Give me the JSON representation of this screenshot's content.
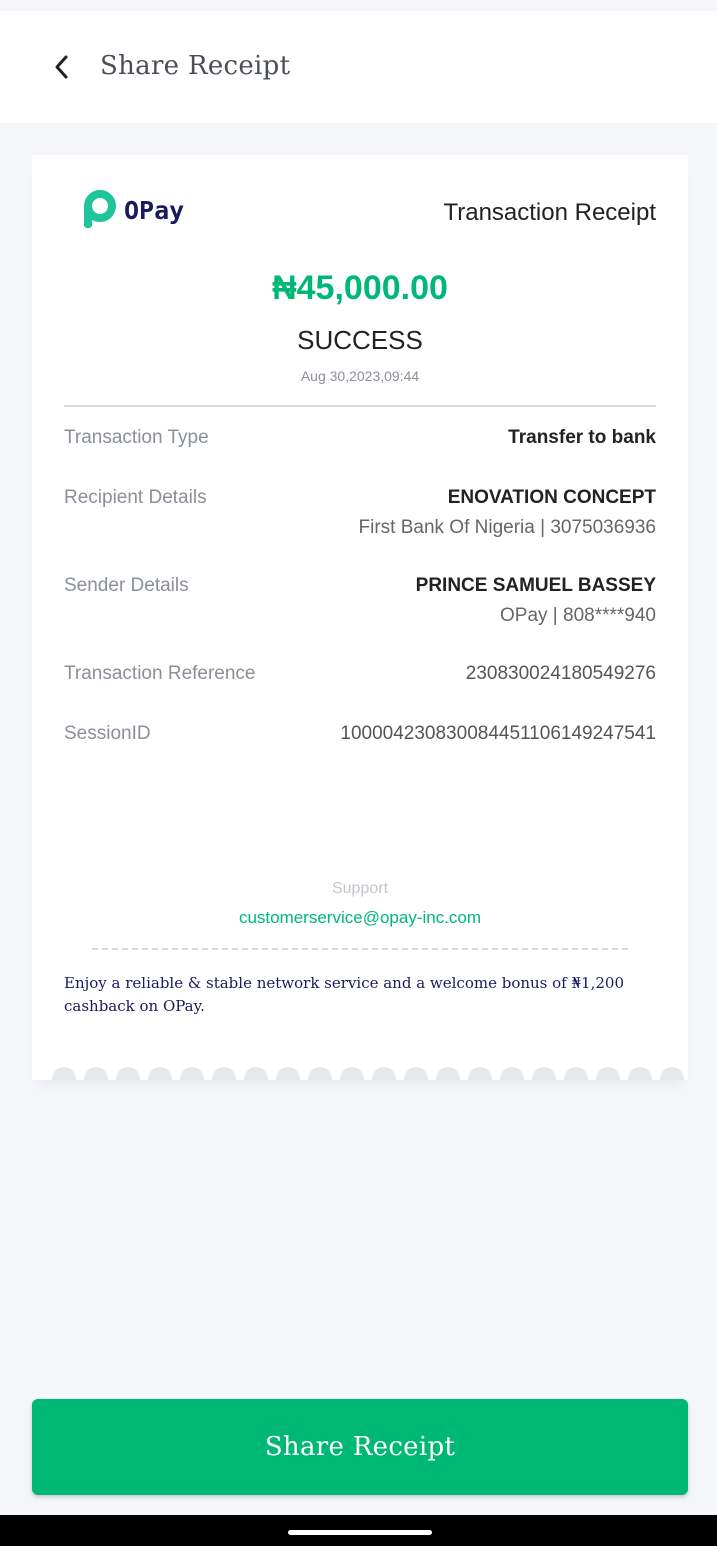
{
  "header": {
    "title": "Share Receipt",
    "back_icon": "chevron-left-icon"
  },
  "receipt": {
    "brand": "OPay",
    "title": "Transaction Receipt",
    "amount": "₦45,000.00",
    "status": "SUCCESS",
    "datetime": "Aug 30,2023,09:44",
    "rows": {
      "type": {
        "label": "Transaction Type",
        "value": "Transfer to bank"
      },
      "recipient": {
        "label": "Recipient Details",
        "name": "ENOVATION CONCEPT",
        "detail": "First Bank Of Nigeria | 3075036936"
      },
      "sender": {
        "label": "Sender Details",
        "name": "PRINCE SAMUEL BASSEY",
        "detail": "OPay | 808****940"
      },
      "reference": {
        "label": "Transaction Reference",
        "value": "230830024180549276"
      },
      "session": {
        "label": "SessionID",
        "value": "100004230830084451106149247541"
      }
    },
    "support_label": "Support",
    "support_email": "customerservice@opay-inc.com",
    "promo": "Enjoy a reliable & stable network service and a welcome bonus of ₦1,200 cashback on OPay."
  },
  "share_button": {
    "label": "Share Receipt"
  },
  "colors": {
    "accent": "#00b876",
    "brand_text": "#1a1a5e"
  }
}
